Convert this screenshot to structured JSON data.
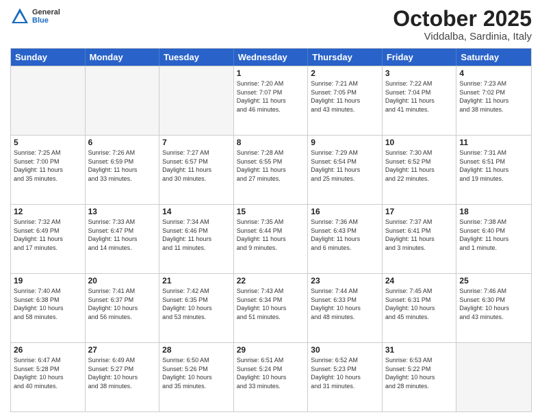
{
  "header": {
    "logo": {
      "general": "General",
      "blue": "Blue"
    },
    "title": "October 2025",
    "location": "Viddalba, Sardinia, Italy"
  },
  "weekdays": [
    "Sunday",
    "Monday",
    "Tuesday",
    "Wednesday",
    "Thursday",
    "Friday",
    "Saturday"
  ],
  "rows": [
    [
      {
        "day": "",
        "info": "",
        "empty": true
      },
      {
        "day": "",
        "info": "",
        "empty": true
      },
      {
        "day": "",
        "info": "",
        "empty": true
      },
      {
        "day": "1",
        "info": "Sunrise: 7:20 AM\nSunset: 7:07 PM\nDaylight: 11 hours\nand 46 minutes."
      },
      {
        "day": "2",
        "info": "Sunrise: 7:21 AM\nSunset: 7:05 PM\nDaylight: 11 hours\nand 43 minutes."
      },
      {
        "day": "3",
        "info": "Sunrise: 7:22 AM\nSunset: 7:04 PM\nDaylight: 11 hours\nand 41 minutes."
      },
      {
        "day": "4",
        "info": "Sunrise: 7:23 AM\nSunset: 7:02 PM\nDaylight: 11 hours\nand 38 minutes."
      }
    ],
    [
      {
        "day": "5",
        "info": "Sunrise: 7:25 AM\nSunset: 7:00 PM\nDaylight: 11 hours\nand 35 minutes."
      },
      {
        "day": "6",
        "info": "Sunrise: 7:26 AM\nSunset: 6:59 PM\nDaylight: 11 hours\nand 33 minutes."
      },
      {
        "day": "7",
        "info": "Sunrise: 7:27 AM\nSunset: 6:57 PM\nDaylight: 11 hours\nand 30 minutes."
      },
      {
        "day": "8",
        "info": "Sunrise: 7:28 AM\nSunset: 6:55 PM\nDaylight: 11 hours\nand 27 minutes."
      },
      {
        "day": "9",
        "info": "Sunrise: 7:29 AM\nSunset: 6:54 PM\nDaylight: 11 hours\nand 25 minutes."
      },
      {
        "day": "10",
        "info": "Sunrise: 7:30 AM\nSunset: 6:52 PM\nDaylight: 11 hours\nand 22 minutes."
      },
      {
        "day": "11",
        "info": "Sunrise: 7:31 AM\nSunset: 6:51 PM\nDaylight: 11 hours\nand 19 minutes."
      }
    ],
    [
      {
        "day": "12",
        "info": "Sunrise: 7:32 AM\nSunset: 6:49 PM\nDaylight: 11 hours\nand 17 minutes."
      },
      {
        "day": "13",
        "info": "Sunrise: 7:33 AM\nSunset: 6:47 PM\nDaylight: 11 hours\nand 14 minutes."
      },
      {
        "day": "14",
        "info": "Sunrise: 7:34 AM\nSunset: 6:46 PM\nDaylight: 11 hours\nand 11 minutes."
      },
      {
        "day": "15",
        "info": "Sunrise: 7:35 AM\nSunset: 6:44 PM\nDaylight: 11 hours\nand 9 minutes."
      },
      {
        "day": "16",
        "info": "Sunrise: 7:36 AM\nSunset: 6:43 PM\nDaylight: 11 hours\nand 6 minutes."
      },
      {
        "day": "17",
        "info": "Sunrise: 7:37 AM\nSunset: 6:41 PM\nDaylight: 11 hours\nand 3 minutes."
      },
      {
        "day": "18",
        "info": "Sunrise: 7:38 AM\nSunset: 6:40 PM\nDaylight: 11 hours\nand 1 minute."
      }
    ],
    [
      {
        "day": "19",
        "info": "Sunrise: 7:40 AM\nSunset: 6:38 PM\nDaylight: 10 hours\nand 58 minutes."
      },
      {
        "day": "20",
        "info": "Sunrise: 7:41 AM\nSunset: 6:37 PM\nDaylight: 10 hours\nand 56 minutes."
      },
      {
        "day": "21",
        "info": "Sunrise: 7:42 AM\nSunset: 6:35 PM\nDaylight: 10 hours\nand 53 minutes."
      },
      {
        "day": "22",
        "info": "Sunrise: 7:43 AM\nSunset: 6:34 PM\nDaylight: 10 hours\nand 51 minutes."
      },
      {
        "day": "23",
        "info": "Sunrise: 7:44 AM\nSunset: 6:33 PM\nDaylight: 10 hours\nand 48 minutes."
      },
      {
        "day": "24",
        "info": "Sunrise: 7:45 AM\nSunset: 6:31 PM\nDaylight: 10 hours\nand 45 minutes."
      },
      {
        "day": "25",
        "info": "Sunrise: 7:46 AM\nSunset: 6:30 PM\nDaylight: 10 hours\nand 43 minutes."
      }
    ],
    [
      {
        "day": "26",
        "info": "Sunrise: 6:47 AM\nSunset: 5:28 PM\nDaylight: 10 hours\nand 40 minutes."
      },
      {
        "day": "27",
        "info": "Sunrise: 6:49 AM\nSunset: 5:27 PM\nDaylight: 10 hours\nand 38 minutes."
      },
      {
        "day": "28",
        "info": "Sunrise: 6:50 AM\nSunset: 5:26 PM\nDaylight: 10 hours\nand 35 minutes."
      },
      {
        "day": "29",
        "info": "Sunrise: 6:51 AM\nSunset: 5:24 PM\nDaylight: 10 hours\nand 33 minutes."
      },
      {
        "day": "30",
        "info": "Sunrise: 6:52 AM\nSunset: 5:23 PM\nDaylight: 10 hours\nand 31 minutes."
      },
      {
        "day": "31",
        "info": "Sunrise: 6:53 AM\nSunset: 5:22 PM\nDaylight: 10 hours\nand 28 minutes."
      },
      {
        "day": "",
        "info": "",
        "empty": true
      }
    ]
  ]
}
